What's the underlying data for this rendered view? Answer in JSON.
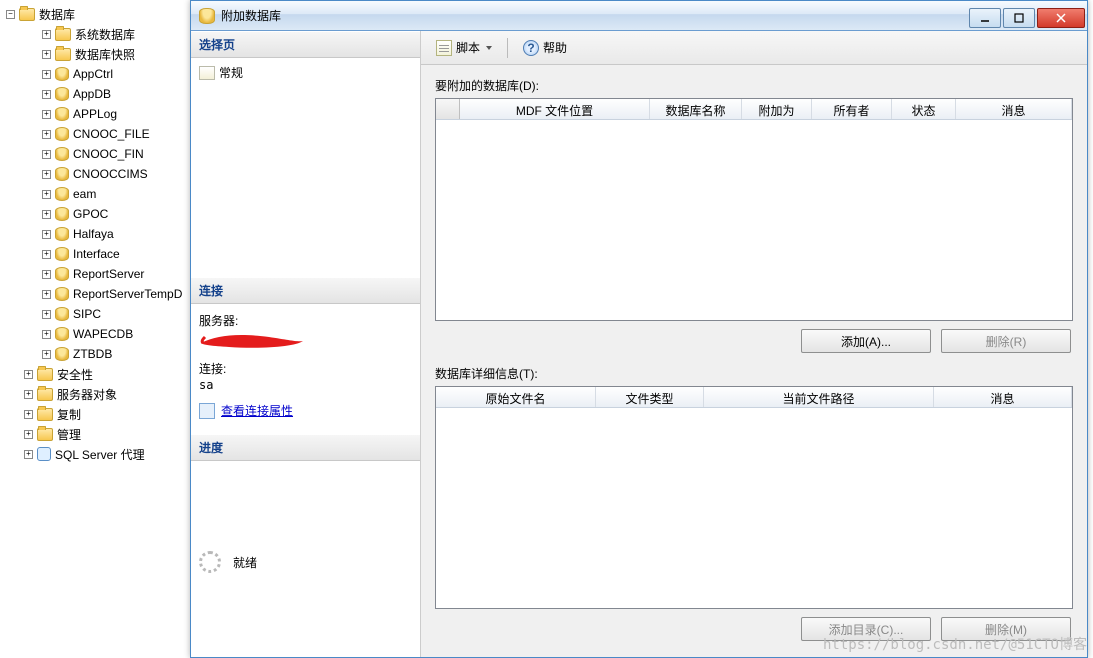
{
  "tree": {
    "root": "数据库",
    "children": [
      {
        "label": "系统数据库",
        "icon": "folder"
      },
      {
        "label": "数据库快照",
        "icon": "folder"
      },
      {
        "label": "AppCtrl",
        "icon": "db"
      },
      {
        "label": "AppDB",
        "icon": "db"
      },
      {
        "label": "APPLog",
        "icon": "db"
      },
      {
        "label": "CNOOC_FILE",
        "icon": "db"
      },
      {
        "label": "CNOOC_FIN",
        "icon": "db"
      },
      {
        "label": "CNOOCCIMS",
        "icon": "db"
      },
      {
        "label": "eam",
        "icon": "db"
      },
      {
        "label": "GPOC",
        "icon": "db"
      },
      {
        "label": "Halfaya",
        "icon": "db"
      },
      {
        "label": "Interface",
        "icon": "db"
      },
      {
        "label": "ReportServer",
        "icon": "db"
      },
      {
        "label": "ReportServerTempD",
        "icon": "db"
      },
      {
        "label": "SIPC",
        "icon": "db"
      },
      {
        "label": "WAPECDB",
        "icon": "db"
      },
      {
        "label": "ZTBDB",
        "icon": "db"
      }
    ],
    "siblings": [
      {
        "label": "安全性",
        "icon": "folder"
      },
      {
        "label": "服务器对象",
        "icon": "folder"
      },
      {
        "label": "复制",
        "icon": "folder"
      },
      {
        "label": "管理",
        "icon": "folder"
      },
      {
        "label": "SQL Server 代理",
        "icon": "agent"
      }
    ]
  },
  "dialog": {
    "title": "附加数据库",
    "side": {
      "select_page_h": "选择页",
      "general_page": "常规",
      "connection_h": "连接",
      "server_label": "服务器:",
      "conn_label": "连接:",
      "conn_value": "sa",
      "view_props": "查看连接属性",
      "progress_h": "进度",
      "progress_state": "就绪"
    },
    "toolbar": {
      "script": "脚本",
      "help": "帮助"
    },
    "main": {
      "attach_label": "要附加的数据库(D):",
      "attach_cols": [
        "MDF 文件位置",
        "数据库名称",
        "附加为",
        "所有者",
        "状态",
        "消息"
      ],
      "add_btn": "添加(A)...",
      "remove_btn": "删除(R)",
      "detail_label": "数据库详细信息(T):",
      "detail_cols": [
        "原始文件名",
        "文件类型",
        "当前文件路径",
        "消息"
      ],
      "add_dir_btn": "添加目录(C)...",
      "remove2_btn": "删除(M)"
    }
  },
  "watermark": "https://blog.csdn.net/@51CTO博客"
}
